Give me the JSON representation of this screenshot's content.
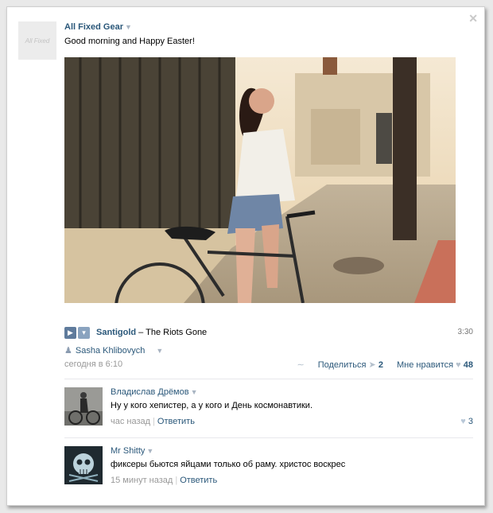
{
  "post": {
    "avatar_text": "All Fixed",
    "author": "All Fixed Gear",
    "caret": "▼",
    "text": "Good morning and Happy Easter!",
    "close": "✕"
  },
  "audio": {
    "artist": "Santigold",
    "dash": " – ",
    "title": "The Riots Gone",
    "duration": "3:30"
  },
  "repost": {
    "name": "Sasha Khlibovych"
  },
  "meta": {
    "time": "сегодня в 6:10",
    "share_label": "Поделиться",
    "share_count": "2",
    "like_label": "Мне нравится",
    "like_count": "48"
  },
  "comments": [
    {
      "author": "Владислав Дрёмов",
      "text": "Ну у кого хепистер, а у кого и День космонавтики.",
      "time": "час назад",
      "reply": "Ответить",
      "likes": "3"
    },
    {
      "author": "Mr Shitty",
      "text": "фиксеры бьются яйцами только об раму. христос воскрес",
      "time": "15 минут назад",
      "reply": "Ответить"
    }
  ],
  "icons": {
    "play": "play-icon",
    "add": "add-icon",
    "heart": "heart-icon",
    "share": "share-icon"
  },
  "colors": {
    "link": "#2b587a",
    "muted": "#999999",
    "play_button": "#5f7b9c"
  }
}
